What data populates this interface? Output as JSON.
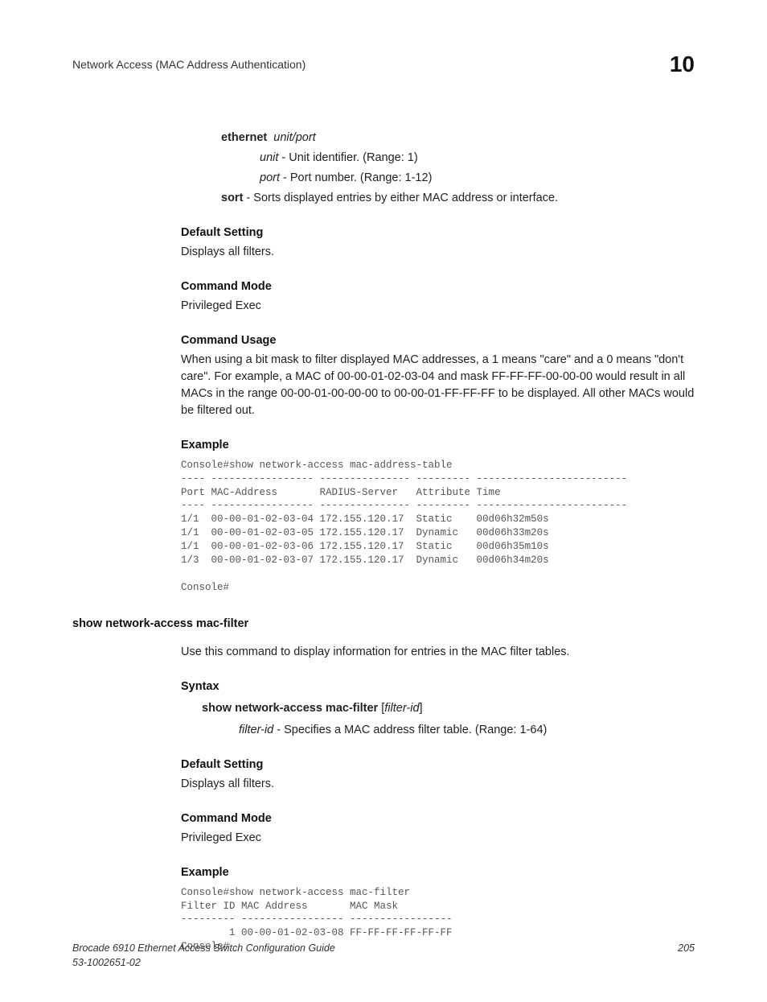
{
  "header": {
    "section_title": "Network Access (MAC Address Authentication)",
    "chapter_number": "10"
  },
  "params": {
    "ethernet_label": "ethernet",
    "ethernet_arg": "unit/port",
    "unit_label": "unit",
    "unit_desc": " - Unit identifier. (Range: 1)",
    "port_label": "port",
    "port_desc": " - Port number. (Range: 1-12)",
    "sort_label": "sort",
    "sort_desc": " - Sorts displayed entries by either MAC address or interface."
  },
  "default_setting": {
    "heading": "Default Setting",
    "text": "Displays all filters."
  },
  "command_mode": {
    "heading": "Command Mode",
    "text": "Privileged Exec"
  },
  "command_usage": {
    "heading": "Command Usage",
    "text": "When using a bit mask to filter displayed MAC addresses, a 1 means \"care\" and a 0 means \"don't care\". For example, a MAC of 00-00-01-02-03-04 and mask FF-FF-FF-00-00-00 would result in all MACs in the range 00-00-01-00-00-00 to 00-00-01-FF-FF-FF to be displayed. All other MACs would be filtered out."
  },
  "example1": {
    "heading": "Example",
    "console": "Console#show network-access mac-address-table\n---- ----------------- --------------- --------- -------------------------\nPort MAC-Address       RADIUS-Server   Attribute Time\n---- ----------------- --------------- --------- -------------------------\n1/1  00-00-01-02-03-04 172.155.120.17  Static    00d06h32m50s\n1/1  00-00-01-02-03-05 172.155.120.17  Dynamic   00d06h33m20s\n1/1  00-00-01-02-03-06 172.155.120.17  Static    00d06h35m10s\n1/3  00-00-01-02-03-07 172.155.120.17  Dynamic   00d06h34m20s\n\nConsole#"
  },
  "cmd2": {
    "title": "show network-access mac-filter",
    "intro": "Use this command to display information for entries in the MAC filter tables.",
    "syntax_heading": "Syntax",
    "syntax_cmd": "show network-access mac-filter",
    "syntax_arg": "filter-id",
    "filterid_label": "filter-id",
    "filterid_desc": " - Specifies a MAC address filter table. (Range: 1-64)",
    "default_heading": "Default Setting",
    "default_text": "Displays all filters.",
    "mode_heading": "Command Mode",
    "mode_text": "Privileged Exec",
    "example_heading": "Example",
    "console": "Console#show network-access mac-filter\nFilter ID MAC Address       MAC Mask\n--------- ----------------- -----------------\n        1 00-00-01-02-03-08 FF-FF-FF-FF-FF-FF\nConsole#"
  },
  "footer": {
    "line1": "Brocade 6910 Ethernet Access Switch Configuration Guide",
    "line2": "53-1002651-02",
    "page": "205"
  }
}
